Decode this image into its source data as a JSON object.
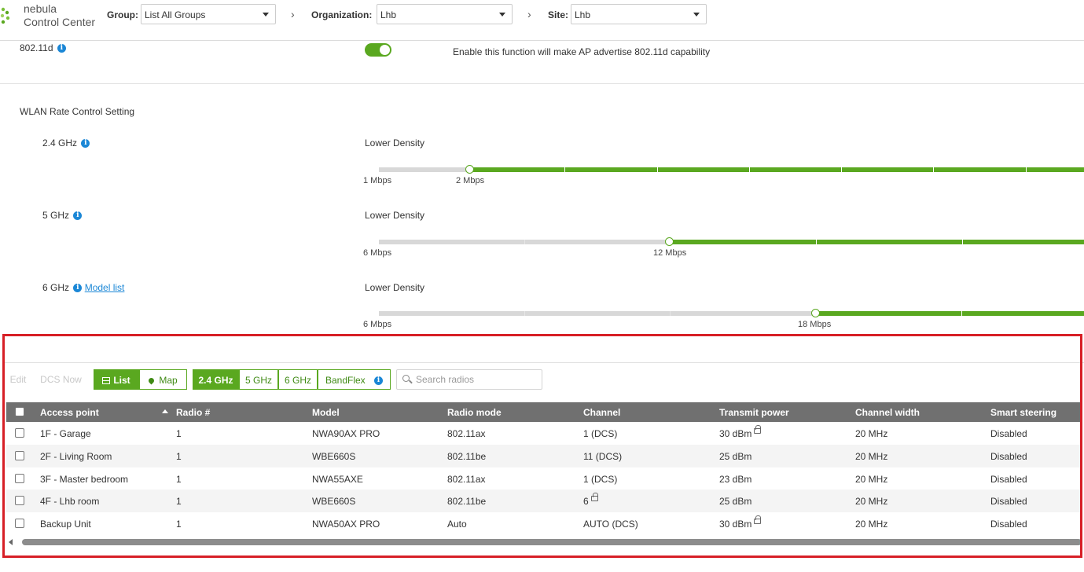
{
  "header": {
    "brand_line1": "nebula",
    "brand_line2": "Control Center",
    "group_label": "Group:",
    "group_value": "List All Groups",
    "org_label": "Organization:",
    "org_value": "Lhb",
    "site_label": "Site:",
    "site_value": "Lhb"
  },
  "settings": {
    "d802_label": "802.11d",
    "d802_enabled": true,
    "d802_desc": "Enable this function will make AP advertise 802.11d capability",
    "rate_title": "WLAN Rate Control Setting",
    "bands": [
      {
        "label": "2.4 GHz",
        "density": "Lower Density",
        "min_label": "1 Mbps",
        "value_label": "2 Mbps"
      },
      {
        "label": "5 GHz",
        "density": "Lower Density",
        "min_label": "6 Mbps",
        "value_label": "12 Mbps"
      },
      {
        "label": "6 GHz",
        "link": "Model list",
        "density": "Lower Density",
        "min_label": "6 Mbps",
        "value_label": "18 Mbps"
      }
    ]
  },
  "toolbar": {
    "edit": "Edit",
    "dcs_now": "DCS Now",
    "list": "List",
    "map": "Map",
    "band_24": "2.4 GHz",
    "band_5": "5 GHz",
    "band_6": "6 GHz",
    "bandflex": "BandFlex",
    "search_placeholder": "Search radios"
  },
  "table": {
    "headers": [
      "Access point",
      "Radio #",
      "Model",
      "Radio mode",
      "Channel",
      "Transmit power",
      "Channel width",
      "Smart steering"
    ],
    "rows": [
      {
        "ap": "1F - Garage",
        "radio": "1",
        "model": "NWA90AX PRO",
        "mode": "802.11ax",
        "channel": "1 (DCS)",
        "power": "30 dBm",
        "width": "20 MHz",
        "steering": "Disabled"
      },
      {
        "ap": "2F - Living Room",
        "radio": "1",
        "model": "WBE660S",
        "mode": "802.11be",
        "channel": "11 (DCS)",
        "power": "25 dBm",
        "width": "20 MHz",
        "steering": "Disabled"
      },
      {
        "ap": "3F - Master bedroom",
        "radio": "1",
        "model": "NWA55AXE",
        "mode": "802.11ax",
        "channel": "1 (DCS)",
        "power": "23 dBm",
        "width": "20 MHz",
        "steering": "Disabled"
      },
      {
        "ap": "4F - Lhb room",
        "radio": "1",
        "model": "WBE660S",
        "mode": "802.11be",
        "channel": "6",
        "power": "25 dBm",
        "width": "20 MHz",
        "steering": "Disabled"
      },
      {
        "ap": "Backup Unit",
        "radio": "1",
        "model": "NWA50AX PRO",
        "mode": "Auto",
        "channel": "AUTO (DCS)",
        "power": "30 dBm",
        "width": "20 MHz",
        "steering": "Disabled"
      }
    ]
  },
  "colors": {
    "accent": "#5aa820",
    "info": "#1b87d6",
    "highlight_border": "#d71f26",
    "table_header": "#707070"
  }
}
